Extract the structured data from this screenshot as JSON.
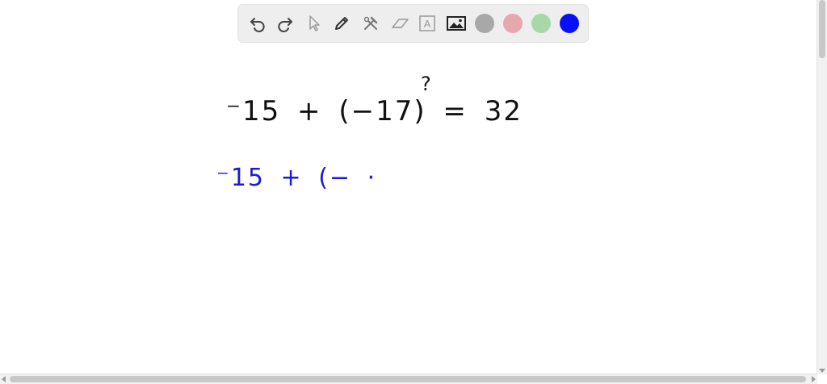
{
  "toolbar": {
    "tools": [
      {
        "icon": "undo-icon"
      },
      {
        "icon": "redo-icon"
      },
      {
        "icon": "pointer-icon"
      },
      {
        "icon": "pen-icon"
      },
      {
        "icon": "tools-icon"
      },
      {
        "icon": "eraser-icon"
      },
      {
        "icon": "text-icon",
        "label": "A"
      },
      {
        "icon": "image-icon"
      }
    ],
    "colors": [
      {
        "name": "gray",
        "hex": "#a8a8a8"
      },
      {
        "name": "pink",
        "hex": "#e8a6ad"
      },
      {
        "name": "green",
        "hex": "#a7d8a7"
      },
      {
        "name": "blue",
        "hex": "#0a10f5"
      }
    ],
    "selected_color": "blue"
  },
  "canvas": {
    "line1": "⁻15 + (−17) = 32",
    "line1_mark": "?",
    "line1_color": "#111111",
    "line2": "⁻15 + (− ·",
    "line2_color": "#1a1adc"
  }
}
